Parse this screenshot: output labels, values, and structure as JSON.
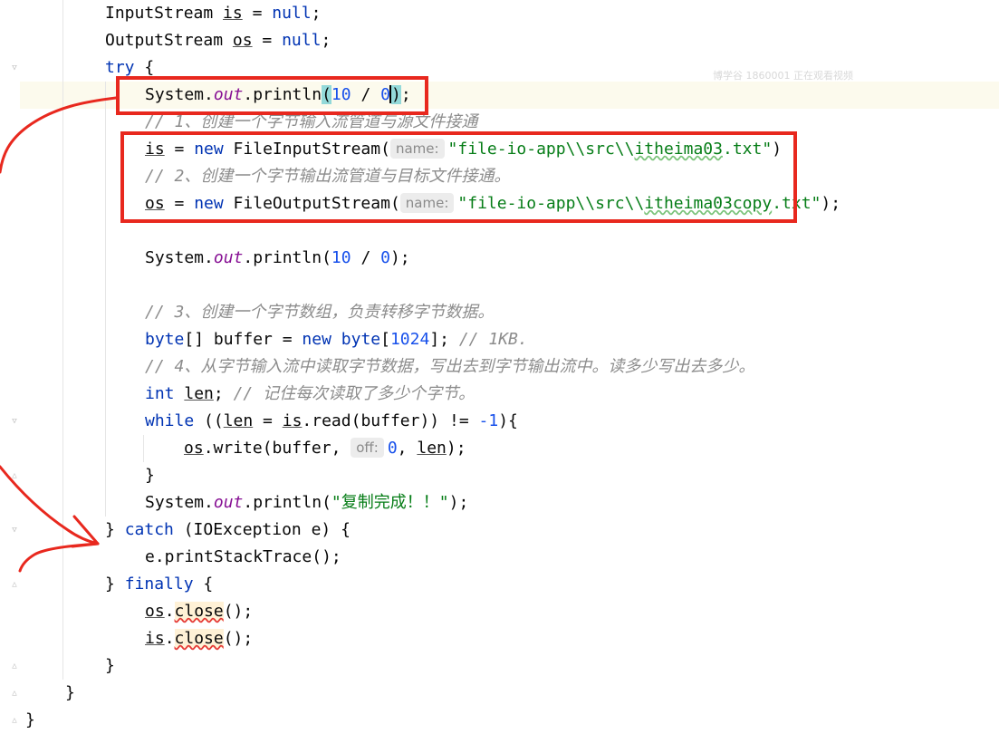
{
  "editor": {
    "watermark": "博学谷 1860001 正在观看视频",
    "lines": {
      "l1_a": "InputStream ",
      "l1_b": "is",
      "l1_c": " = ",
      "l1_d": "null",
      "l1_e": ";",
      "l2_a": "OutputStream ",
      "l2_b": "os",
      "l2_c": " = ",
      "l2_d": "null",
      "l2_e": ";",
      "l3_a": "try",
      "l3_b": " {",
      "l4_a": "System.",
      "l4_b": "out",
      "l4_c": ".println",
      "l4_d": "(",
      "l4_e": "10",
      "l4_f": " / ",
      "l4_g": "0",
      "l4_h": ")",
      "l4_i": ";",
      "l5": "// 1、创建一个字节输入流管道与源文件接通",
      "l6_a": "is",
      "l6_b": " = ",
      "l6_c": "new",
      "l6_d": " FileInputStream(",
      "l6_hint": "name:",
      "l6_e": "\"file-io-app\\\\src\\\\",
      "l6_f": "itheima03",
      "l6_g": ".txt\"",
      "l6_h": ")",
      "l7": "// 2、创建一个字节输出流管道与目标文件接通。",
      "l8_a": "os",
      "l8_b": " = ",
      "l8_c": "new",
      "l8_d": " FileOutputStream(",
      "l8_hint": "name:",
      "l8_e": "\"file-io-app\\\\src\\\\",
      "l8_f": "itheima03copy",
      "l8_g": ".txt\"",
      "l8_h": ");",
      "l9_a": "System.",
      "l9_b": "out",
      "l9_c": ".println(",
      "l9_d": "10",
      "l9_e": " / ",
      "l9_f": "0",
      "l9_g": ");",
      "l10": "// 3、创建一个字节数组，负责转移字节数据。",
      "l11_a": "byte",
      "l11_b": "[] buffer = ",
      "l11_c": "new",
      "l11_d": " ",
      "l11_e": "byte",
      "l11_f": "[",
      "l11_g": "1024",
      "l11_h": "]; ",
      "l11_i": "// 1KB.",
      "l12": "// 4、从字节输入流中读取字节数据，写出去到字节输出流中。读多少写出去多少。",
      "l13_a": "int",
      "l13_b": " ",
      "l13_c": "len",
      "l13_d": "; ",
      "l13_e": "// 记住每次读取了多少个字节。",
      "l14_a": "while",
      "l14_b": " ((",
      "l14_c": "len",
      "l14_d": " = ",
      "l14_e": "is",
      "l14_f": ".read(buffer)) != ",
      "l14_g": "-1",
      "l14_h": "){",
      "l15_a": "os",
      "l15_b": ".write(buffer, ",
      "l15_hint": "off:",
      "l15_c": "0",
      "l15_d": ", ",
      "l15_e": "len",
      "l15_f": ");",
      "l16": "}",
      "l17_a": "System.",
      "l17_b": "out",
      "l17_c": ".println(",
      "l17_d": "\"复制完成！！\"",
      "l17_e": ");",
      "l18_a": "} ",
      "l18_b": "catch",
      "l18_c": " (IOException e) {",
      "l19": "e.printStackTrace();",
      "l20_a": "} ",
      "l20_b": "finally",
      "l20_c": " {",
      "l21_a": "os",
      "l21_b": ".",
      "l21_c": "close",
      "l21_d": "();",
      "l22_a": "is",
      "l22_b": ".",
      "l22_c": "close",
      "l22_d": "();",
      "l23": "}",
      "l24": "}",
      "l25": "}"
    }
  },
  "colors": {
    "keyword": "#0033b3",
    "number": "#1750eb",
    "string": "#067d17",
    "comment": "#8c8c8c",
    "static_field": "#871094",
    "annotation_red": "#e8281e"
  }
}
